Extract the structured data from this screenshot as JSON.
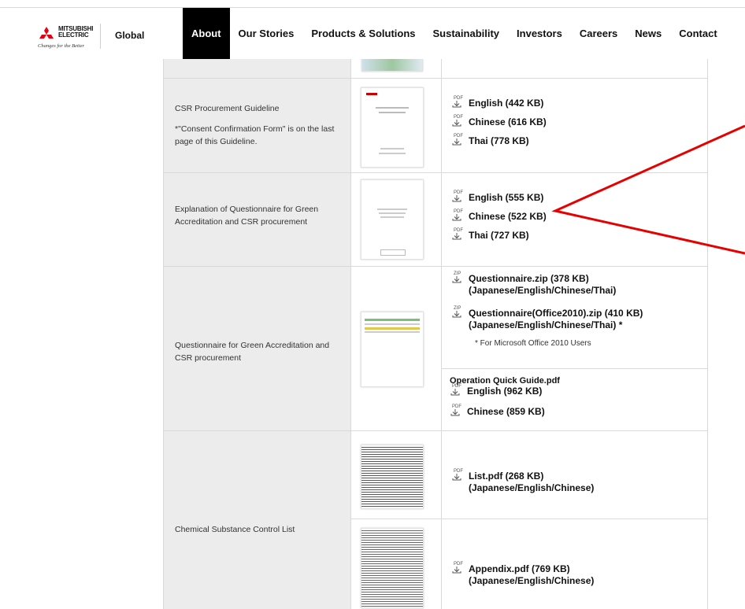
{
  "header": {
    "logo_brand_line1": "MITSUBISHI",
    "logo_brand_line2": "ELECTRIC",
    "logo_tagline": "Changes for the Better",
    "global_label": "Global",
    "nav": [
      "About",
      "Our Stories",
      "Products & Solutions",
      "Sustainability",
      "Investors",
      "Careers",
      "News",
      "Contact"
    ],
    "active_nav": "About"
  },
  "icons": {
    "pdf": "PDF",
    "zip": "ZIP"
  },
  "rows": {
    "csr_guideline": {
      "label": "CSR Procurement Guideline",
      "note": "*\"Consent Confirmation Form\" is on the last page of this Guideline.",
      "links": [
        "English (442 KB)",
        "Chinese (616 KB)",
        "Thai (778 KB)"
      ]
    },
    "explanation": {
      "label": "Explanation of Questionnaire for Green Accreditation and CSR procurement",
      "links": [
        "English (555 KB)",
        "Chinese (522 KB)",
        "Thai (727 KB)"
      ]
    },
    "questionnaire": {
      "label": "Questionnaire for Green Accreditation and CSR procurement",
      "zip1": "Questionnaire.zip (378 KB)",
      "zip1_langs": "(Japanese/English/Chinese/Thai)",
      "zip2": "Questionnaire(Office2010).zip (410 KB)",
      "zip2_langs": "(Japanese/English/Chinese/Thai) *",
      "footnote": "*  For Microsoft Office 2010 Users",
      "guide_title": "Operation Quick Guide.pdf",
      "guide_links": [
        "English (962 KB)",
        "Chinese (859 KB)"
      ]
    },
    "chemical": {
      "label": "Chemical Substance Control List",
      "list_pdf": "List.pdf (268 KB)",
      "list_langs": "(Japanese/English/Chinese)",
      "appendix_pdf": "Appendix.pdf (769 KB)",
      "appendix_langs": "(Japanese/English/Chinese)"
    }
  },
  "colors": {
    "arrow": "#e60000",
    "label_bg": "#ececec",
    "active_nav_bg": "#000000"
  }
}
